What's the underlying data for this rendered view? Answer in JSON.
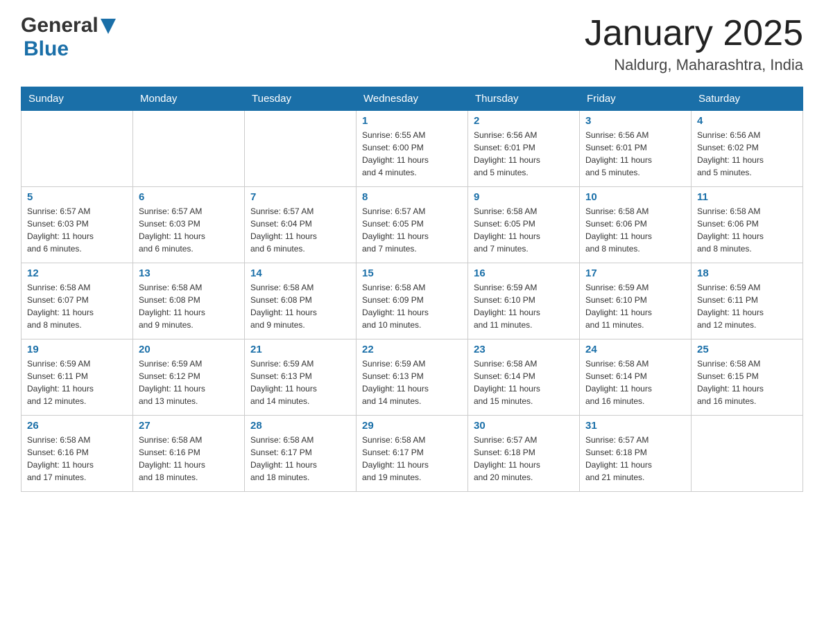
{
  "header": {
    "logo_general": "General",
    "logo_blue": "Blue",
    "month_title": "January 2025",
    "location": "Naldurg, Maharashtra, India"
  },
  "days_of_week": [
    "Sunday",
    "Monday",
    "Tuesday",
    "Wednesday",
    "Thursday",
    "Friday",
    "Saturday"
  ],
  "weeks": [
    [
      {
        "day": "",
        "info": ""
      },
      {
        "day": "",
        "info": ""
      },
      {
        "day": "",
        "info": ""
      },
      {
        "day": "1",
        "info": "Sunrise: 6:55 AM\nSunset: 6:00 PM\nDaylight: 11 hours\nand 4 minutes."
      },
      {
        "day": "2",
        "info": "Sunrise: 6:56 AM\nSunset: 6:01 PM\nDaylight: 11 hours\nand 5 minutes."
      },
      {
        "day": "3",
        "info": "Sunrise: 6:56 AM\nSunset: 6:01 PM\nDaylight: 11 hours\nand 5 minutes."
      },
      {
        "day": "4",
        "info": "Sunrise: 6:56 AM\nSunset: 6:02 PM\nDaylight: 11 hours\nand 5 minutes."
      }
    ],
    [
      {
        "day": "5",
        "info": "Sunrise: 6:57 AM\nSunset: 6:03 PM\nDaylight: 11 hours\nand 6 minutes."
      },
      {
        "day": "6",
        "info": "Sunrise: 6:57 AM\nSunset: 6:03 PM\nDaylight: 11 hours\nand 6 minutes."
      },
      {
        "day": "7",
        "info": "Sunrise: 6:57 AM\nSunset: 6:04 PM\nDaylight: 11 hours\nand 6 minutes."
      },
      {
        "day": "8",
        "info": "Sunrise: 6:57 AM\nSunset: 6:05 PM\nDaylight: 11 hours\nand 7 minutes."
      },
      {
        "day": "9",
        "info": "Sunrise: 6:58 AM\nSunset: 6:05 PM\nDaylight: 11 hours\nand 7 minutes."
      },
      {
        "day": "10",
        "info": "Sunrise: 6:58 AM\nSunset: 6:06 PM\nDaylight: 11 hours\nand 8 minutes."
      },
      {
        "day": "11",
        "info": "Sunrise: 6:58 AM\nSunset: 6:06 PM\nDaylight: 11 hours\nand 8 minutes."
      }
    ],
    [
      {
        "day": "12",
        "info": "Sunrise: 6:58 AM\nSunset: 6:07 PM\nDaylight: 11 hours\nand 8 minutes."
      },
      {
        "day": "13",
        "info": "Sunrise: 6:58 AM\nSunset: 6:08 PM\nDaylight: 11 hours\nand 9 minutes."
      },
      {
        "day": "14",
        "info": "Sunrise: 6:58 AM\nSunset: 6:08 PM\nDaylight: 11 hours\nand 9 minutes."
      },
      {
        "day": "15",
        "info": "Sunrise: 6:58 AM\nSunset: 6:09 PM\nDaylight: 11 hours\nand 10 minutes."
      },
      {
        "day": "16",
        "info": "Sunrise: 6:59 AM\nSunset: 6:10 PM\nDaylight: 11 hours\nand 11 minutes."
      },
      {
        "day": "17",
        "info": "Sunrise: 6:59 AM\nSunset: 6:10 PM\nDaylight: 11 hours\nand 11 minutes."
      },
      {
        "day": "18",
        "info": "Sunrise: 6:59 AM\nSunset: 6:11 PM\nDaylight: 11 hours\nand 12 minutes."
      }
    ],
    [
      {
        "day": "19",
        "info": "Sunrise: 6:59 AM\nSunset: 6:11 PM\nDaylight: 11 hours\nand 12 minutes."
      },
      {
        "day": "20",
        "info": "Sunrise: 6:59 AM\nSunset: 6:12 PM\nDaylight: 11 hours\nand 13 minutes."
      },
      {
        "day": "21",
        "info": "Sunrise: 6:59 AM\nSunset: 6:13 PM\nDaylight: 11 hours\nand 14 minutes."
      },
      {
        "day": "22",
        "info": "Sunrise: 6:59 AM\nSunset: 6:13 PM\nDaylight: 11 hours\nand 14 minutes."
      },
      {
        "day": "23",
        "info": "Sunrise: 6:58 AM\nSunset: 6:14 PM\nDaylight: 11 hours\nand 15 minutes."
      },
      {
        "day": "24",
        "info": "Sunrise: 6:58 AM\nSunset: 6:14 PM\nDaylight: 11 hours\nand 16 minutes."
      },
      {
        "day": "25",
        "info": "Sunrise: 6:58 AM\nSunset: 6:15 PM\nDaylight: 11 hours\nand 16 minutes."
      }
    ],
    [
      {
        "day": "26",
        "info": "Sunrise: 6:58 AM\nSunset: 6:16 PM\nDaylight: 11 hours\nand 17 minutes."
      },
      {
        "day": "27",
        "info": "Sunrise: 6:58 AM\nSunset: 6:16 PM\nDaylight: 11 hours\nand 18 minutes."
      },
      {
        "day": "28",
        "info": "Sunrise: 6:58 AM\nSunset: 6:17 PM\nDaylight: 11 hours\nand 18 minutes."
      },
      {
        "day": "29",
        "info": "Sunrise: 6:58 AM\nSunset: 6:17 PM\nDaylight: 11 hours\nand 19 minutes."
      },
      {
        "day": "30",
        "info": "Sunrise: 6:57 AM\nSunset: 6:18 PM\nDaylight: 11 hours\nand 20 minutes."
      },
      {
        "day": "31",
        "info": "Sunrise: 6:57 AM\nSunset: 6:18 PM\nDaylight: 11 hours\nand 21 minutes."
      },
      {
        "day": "",
        "info": ""
      }
    ]
  ]
}
